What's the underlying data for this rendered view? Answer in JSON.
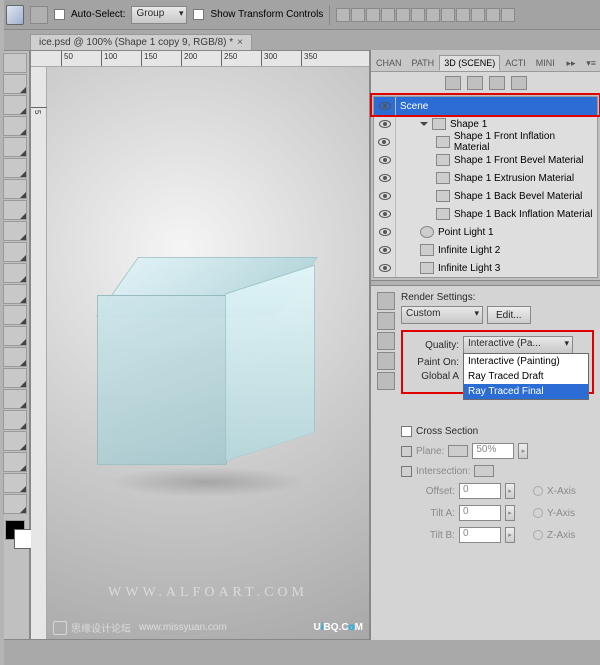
{
  "options_bar": {
    "auto_select_label": "Auto-Select:",
    "auto_select_mode": "Group",
    "show_transform_label": "Show Transform Controls"
  },
  "doc_tab": "ice.psd @ 100% (Shape 1 copy 9, RGB/8) *",
  "ruler_marks": [
    "50",
    "100",
    "150",
    "200",
    "250",
    "300",
    "350"
  ],
  "ruler_marks_v": [
    "5"
  ],
  "panel_tabs": {
    "channels": "CHAN",
    "paths": "PATH",
    "threed": "3D (SCENE)",
    "actions": "ACTI",
    "mini": "MINI"
  },
  "scene_items": {
    "scene": "Scene",
    "shape1": "Shape 1",
    "front_infl": "Shape 1 Front Inflation Material",
    "front_bevel": "Shape 1 Front Bevel Material",
    "extrusion": "Shape 1 Extrusion Material",
    "back_bevel": "Shape 1 Back Bevel Material",
    "back_infl": "Shape 1 Back Inflation Material",
    "pointlight": "Point Light 1",
    "inflight2": "Infinite Light 2",
    "inflight3": "Infinite Light 3"
  },
  "render": {
    "title": "Render Settings:",
    "preset": "Custom",
    "edit_btn": "Edit...",
    "quality_label": "Quality:",
    "quality_value": "Interactive (Pa...",
    "quality_options": [
      "Interactive (Painting)",
      "Ray Traced Draft",
      "Ray Traced Final"
    ],
    "painton_label": "Paint On:",
    "global_label": "Global A",
    "cross_section": "Cross Section",
    "plane_label": "Plane:",
    "plane_val": "50%",
    "intersection_label": "Intersection:",
    "offset_label": "Offset:",
    "offset_val": "0",
    "tilta_label": "Tilt A:",
    "tilta_val": "0",
    "tiltb_label": "Tilt B:",
    "tiltb_val": "0",
    "xaxis": "X-Axis",
    "yaxis": "Y-Axis",
    "zaxis": "Z-Axis"
  },
  "watermark": "WWW.ALFOART.COM",
  "watermark2_a": "思缘设计论坛",
  "watermark2_b": "www.missyuan.com",
  "watermark3": "UiBQ.CoM"
}
